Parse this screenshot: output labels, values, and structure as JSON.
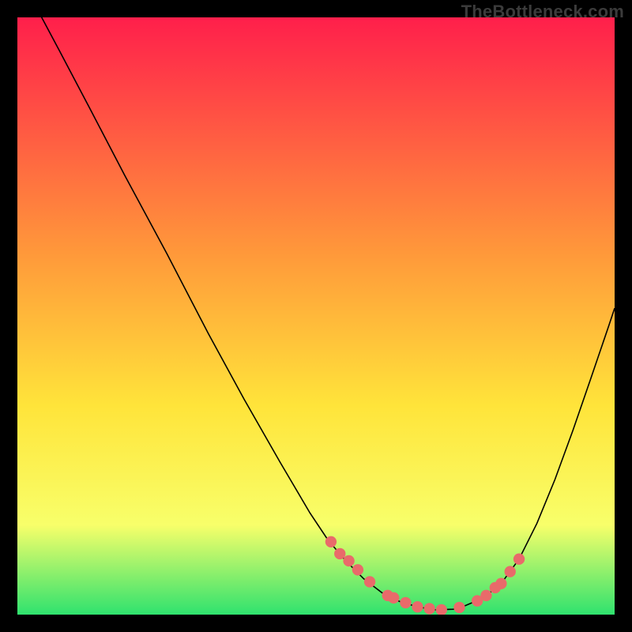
{
  "watermark": "TheBottleneck.com",
  "colors": {
    "background": "#000000",
    "curve": "#000000",
    "dots": "#E96A6A",
    "gradient_top": "#FF1F4B",
    "gradient_mid1": "#FF9A3A",
    "gradient_mid2": "#FFE43A",
    "gradient_mid3": "#F8FF6A",
    "gradient_bottom": "#2FE26E",
    "watermark": "#3b3b3b"
  },
  "chart_data": {
    "type": "line",
    "title": "",
    "xlabel": "",
    "ylabel": "",
    "xlim": [
      0,
      100
    ],
    "ylim": [
      0,
      100
    ],
    "curve": {
      "x": [
        0,
        3,
        7,
        12,
        18,
        25,
        32,
        38,
        44,
        49,
        52,
        55,
        58,
        61,
        64,
        67,
        70,
        73,
        75,
        78,
        81,
        84,
        87,
        90,
        93,
        96,
        99,
        100
      ],
      "y": [
        108,
        102,
        94.5,
        85,
        73.5,
        60.5,
        47,
        36,
        25.5,
        17,
        12.5,
        9,
        6,
        3.7,
        2.2,
        1.3,
        0.8,
        0.9,
        1.5,
        2.8,
        5.2,
        9.3,
        15.3,
        22.6,
        30.8,
        39.5,
        48.3,
        51.3
      ]
    },
    "dots": {
      "x": [
        52.5,
        54,
        55.5,
        57,
        59,
        62,
        63,
        65,
        67,
        69,
        71,
        74,
        77,
        78.5,
        80,
        81,
        82.5,
        84
      ],
      "y": [
        12.2,
        10.2,
        9,
        7.5,
        5.5,
        3.2,
        2.8,
        2,
        1.3,
        1,
        0.8,
        1.2,
        2.3,
        3.2,
        4.5,
        5.2,
        7.2,
        9.3
      ]
    },
    "legend": [],
    "grid": false
  }
}
